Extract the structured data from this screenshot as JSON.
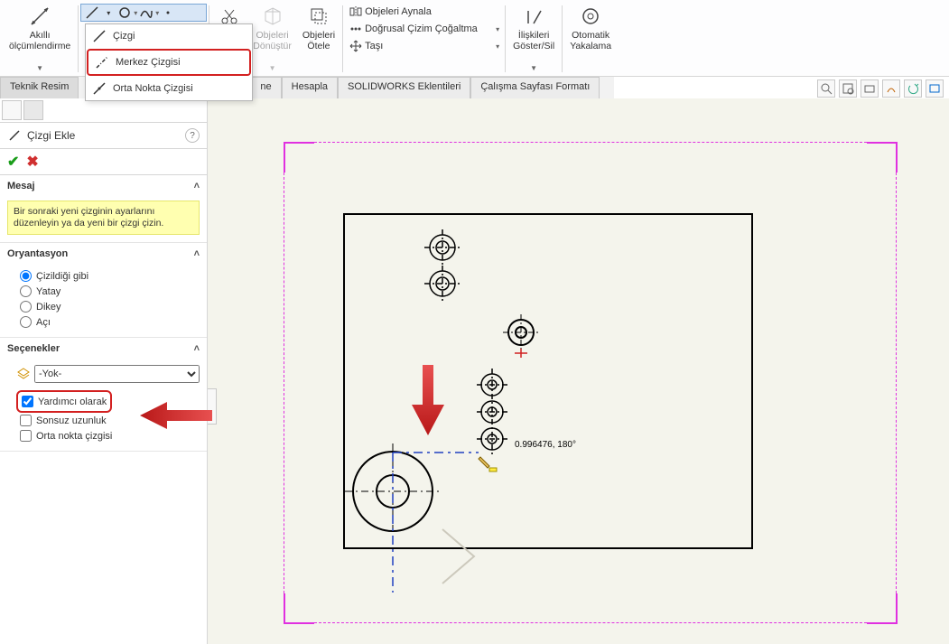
{
  "ribbon": {
    "smart_dim": "Akıllı\nölçümlendirme",
    "convert": "Objeleri\nDönüştür",
    "offset": "Objeleri\nÖtele",
    "mirror": "Objeleri Aynala",
    "pattern": "Doğrusal Çizim Çoğaltma",
    "move": "Taşı",
    "relations": "İlişkileri\nGöster/Sil",
    "autosnap": "Otomatik\nYakalama"
  },
  "dropdown": {
    "line": "Çizgi",
    "centerline": "Merkez Çizgisi",
    "midline": "Orta Nokta Çizgisi"
  },
  "tabs": {
    "t1": "Teknik Resim",
    "t2": "ne",
    "t3": "Hesapla",
    "t4": "SOLIDWORKS Eklentileri",
    "t5": "Çalışma Sayfası Formatı"
  },
  "panel": {
    "title": "Çizgi Ekle",
    "msg_head": "Mesaj",
    "msg_body": "Bir sonraki yeni çizginin ayarlarını düzenleyin ya da yeni bir çizgi çizin.",
    "orient_head": "Oryantasyon",
    "r1": "Çizildiği gibi",
    "r2": "Yatay",
    "r3": "Dikey",
    "r4": "Açı",
    "opts_head": "Seçenekler",
    "sel": "-Yok-",
    "c1": "Yardımcı olarak",
    "c2": "Sonsuz uzunluk",
    "c3": "Orta nokta çizgisi"
  },
  "canvas": {
    "dim": "0.996476, 180°"
  }
}
